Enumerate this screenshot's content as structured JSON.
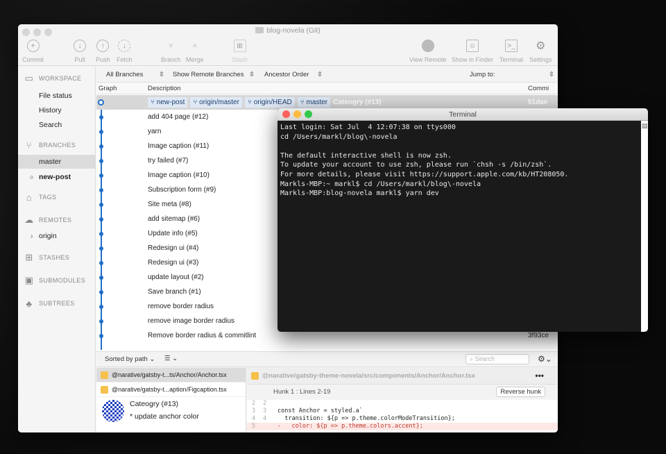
{
  "window": {
    "title": "blog-novela (Git)"
  },
  "toolbar": {
    "commit": "Commit",
    "pull": "Pull",
    "push": "Push",
    "fetch": "Fetch",
    "branch": "Branch",
    "merge": "Merge",
    "stash": "Stash",
    "view_remote": "View Remote",
    "show_in_finder": "Show in Finder",
    "terminal": "Terminal",
    "settings": "Settings"
  },
  "sidebar": {
    "workspace": "WORKSPACE",
    "workspace_items": [
      "File status",
      "History",
      "Search"
    ],
    "branches": "BRANCHES",
    "branch_items": [
      "master",
      "new-post"
    ],
    "tags": "TAGS",
    "remotes": "REMOTES",
    "remote_items": [
      "origin"
    ],
    "stashes": "STASHES",
    "submodules": "SUBMODULES",
    "subtrees": "SUBTREES"
  },
  "filters": {
    "branches": "All Branches",
    "remote": "Show Remote Branches",
    "order": "Ancestor Order",
    "jump": "Jump to:"
  },
  "columns": {
    "graph": "Graph",
    "description": "Description",
    "commit": "Commi"
  },
  "head_row": {
    "tags": [
      "new-post",
      "origin/master",
      "origin/HEAD",
      "master"
    ],
    "description": "Cateogry (#13)",
    "sha": "51dae"
  },
  "commits": [
    "add 404 page (#12)",
    "yarn",
    "Image caption (#11)",
    "try failed (#7)",
    "Image caption (#10)",
    "Subscription form (#9)",
    "Site meta (#8)",
    "add sitemap (#6)",
    "Update info (#5)",
    "Redesign ui (#4)",
    "Redesign ui (#3)",
    "update layout (#2)",
    "Save branch (#1)",
    "remove border radius",
    "remove image border radius",
    "Remove border radius & commitlint"
  ],
  "last_sha": "3f93ce",
  "bottom": {
    "sort": "Sorted by path",
    "search_placeholder": "Search",
    "files": [
      "@narative/gatsby-t...ts/Anchor/Anchor.tsx",
      "@narative/gatsby-t...aption/Figcaption.tsx"
    ],
    "commit_title": "Cateogry (#13)",
    "commit_body": "* update anchor color",
    "diff_path": "@narative/gatsby-theme-novela/src/components/Anchor/Anchor.tsx",
    "hunk": "Hunk 1 : Lines 2-19",
    "reverse_hunk": "Reverse hunk",
    "lines": [
      {
        "a": "2",
        "b": "2",
        "text": "",
        "type": "ctx"
      },
      {
        "a": "3",
        "b": "3",
        "text": "const Anchor = styled.a`",
        "type": "ctx"
      },
      {
        "a": "4",
        "b": "4",
        "text": "  transition: ${p => p.theme.colorModeTransition};",
        "type": "ctx"
      },
      {
        "a": "5",
        "b": "",
        "text": "-   color: ${p => p.theme.colors.accent};",
        "type": "del"
      }
    ]
  },
  "terminal": {
    "title": "Terminal",
    "lines": [
      "Last login: Sat Jul  4 12:07:38 on ttys000",
      "cd /Users/markl/blog\\-novela",
      "",
      "The default interactive shell is now zsh.",
      "To update your account to use zsh, please run `chsh -s /bin/zsh`.",
      "For more details, please visit https://support.apple.com/kb/HT208050.",
      "Markls-MBP:~ markl$ cd /Users/markl/blog\\-novela",
      "Markls-MBP:blog-novela markl$ yarn dev"
    ]
  }
}
